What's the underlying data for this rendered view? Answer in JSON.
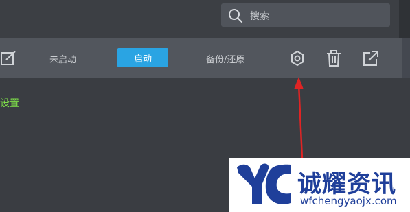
{
  "search": {
    "placeholder": "搜索"
  },
  "toolbar": {
    "not_started_label": "未启动",
    "start_label": "启动",
    "backup_restore_label": "备份/还原"
  },
  "content": {
    "settings_link": "设置"
  },
  "watermark": {
    "brand_cn": "诚耀资讯",
    "brand_url": "wfchengyaojx.com"
  },
  "colors": {
    "accent": "#2aa4e3",
    "arrow": "#e02424",
    "link_green": "#7fe04a",
    "brand_blue": "#1f3f9a"
  },
  "icons": {
    "search": "search-icon",
    "edit": "edit-icon",
    "settings": "gear-icon",
    "delete": "trash-icon",
    "export": "share-icon",
    "annotation": "red-arrow"
  }
}
